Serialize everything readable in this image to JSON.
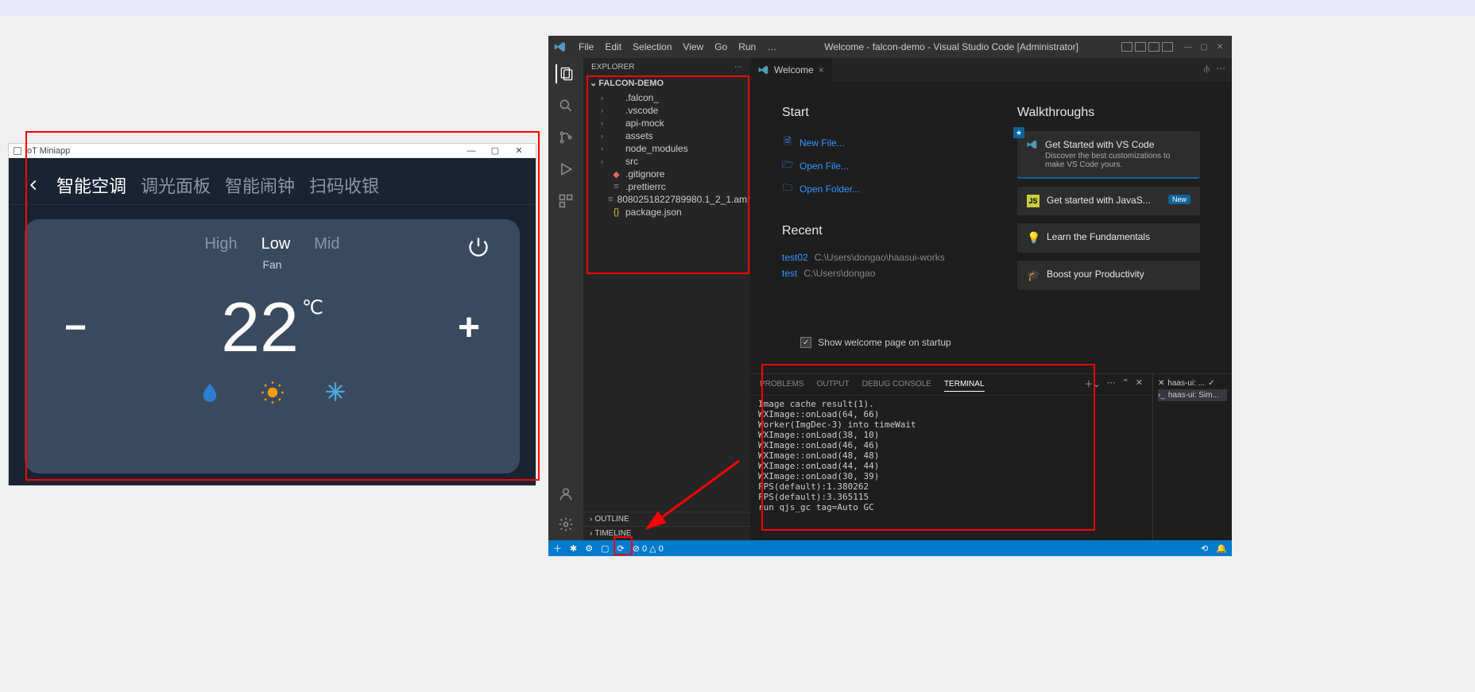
{
  "iot": {
    "window_title": "IoT Miniapp",
    "tabs": [
      "智能空调",
      "调光面板",
      "智能闹钟",
      "扫码收银"
    ],
    "active_tab": 0,
    "fan_modes": [
      "High",
      "Low",
      "Mid"
    ],
    "fan_active": 1,
    "fan_label": "Fan",
    "temperature": "22",
    "temp_unit": "℃",
    "minus": "−",
    "plus": "+"
  },
  "vscode": {
    "menus": [
      "File",
      "Edit",
      "Selection",
      "View",
      "Go",
      "Run",
      "…"
    ],
    "title": "Welcome - falcon-demo - Visual Studio Code [Administrator]",
    "explorer": {
      "title": "EXPLORER",
      "folder": "FALCON-DEMO",
      "items": [
        {
          "name": ".falcon_",
          "type": "folder"
        },
        {
          "name": ".vscode",
          "type": "folder"
        },
        {
          "name": "api-mock",
          "type": "folder"
        },
        {
          "name": "assets",
          "type": "folder"
        },
        {
          "name": "node_modules",
          "type": "folder"
        },
        {
          "name": "src",
          "type": "folder"
        },
        {
          "name": ".gitignore",
          "type": "file-git"
        },
        {
          "name": ".prettierrc",
          "type": "file-txt"
        },
        {
          "name": "8080251822789980.1_2_1.amr",
          "type": "file-txt"
        },
        {
          "name": "package.json",
          "type": "file-json"
        }
      ],
      "outline": "OUTLINE",
      "timeline": "TIMELINE"
    },
    "tab": {
      "label": "Welcome",
      "close": "×"
    },
    "welcome": {
      "start_h": "Start",
      "start_links": [
        {
          "icon": "new",
          "label": "New File..."
        },
        {
          "icon": "open",
          "label": "Open File..."
        },
        {
          "icon": "folder",
          "label": "Open Folder..."
        }
      ],
      "recent_h": "Recent",
      "recent": [
        {
          "name": "test02",
          "path": "C:\\Users\\dongao\\haasui-works"
        },
        {
          "name": "test",
          "path": "C:\\Users\\dongao"
        }
      ],
      "walk_h": "Walkthroughs",
      "walkthroughs": [
        {
          "title": "Get Started with VS Code",
          "desc": "Discover the best customizations to make VS Code yours.",
          "starred": true
        },
        {
          "title": "Get started with JavaS...",
          "badge": "New",
          "icon": "JS"
        },
        {
          "title": "Learn the Fundamentals",
          "icon": "bulb"
        },
        {
          "title": "Boost your Productivity",
          "icon": "grad"
        }
      ],
      "startup_check": "Show welcome page on startup"
    },
    "panel": {
      "tabs": [
        "PROBLEMS",
        "OUTPUT",
        "DEBUG CONSOLE",
        "TERMINAL"
      ],
      "active": 3,
      "terminal_lines": [
        "Image cache result(1).",
        "WXImage::onLoad(64, 66)",
        "Worker(ImgDec-3) into timeWait",
        "WXImage::onLoad(38, 10)",
        "WXImage::onLoad(46, 46)",
        "WXImage::onLoad(48, 48)",
        "WXImage::onLoad(44, 44)",
        "WXImage::onLoad(30, 39)",
        "FPS(default):1.380262",
        "FPS(default):3.365115",
        "run qjs_gc tag=Auto GC"
      ],
      "side_items": [
        "haas-ui: ...",
        "haas-ui: Sim..."
      ]
    },
    "status": {
      "items_left": [
        "＋",
        "✱",
        "⚙",
        "▢",
        "⟳",
        "⊘ 0 △ 0"
      ],
      "items_right": [
        "⟲",
        "🔔"
      ]
    }
  }
}
